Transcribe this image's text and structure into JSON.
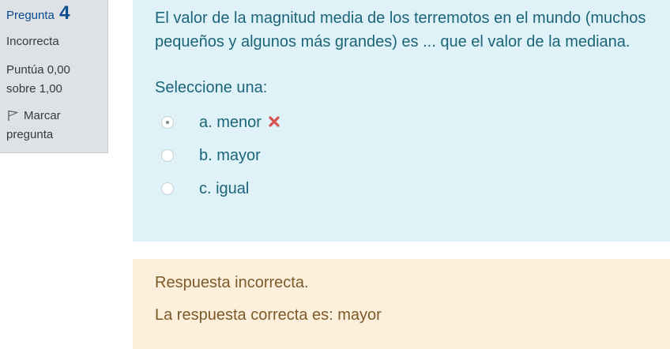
{
  "info": {
    "question_label": "Pregunta",
    "question_number": "4",
    "state": "Incorrecta",
    "grade": "Puntúa 0,00 sobre 1,00",
    "flag_label": "Marcar pregunta",
    "flag_icon": "flag-icon"
  },
  "question": {
    "text": "El valor de la magnitud media de los terremotos en el mundo (muchos pequeños y algunos más grandes) es ... que el valor de la mediana.",
    "prompt": "Seleccione una:",
    "options": [
      {
        "label": "a. menor",
        "selected": true,
        "marked_incorrect": true
      },
      {
        "label": "b. mayor",
        "selected": false
      },
      {
        "label": "c. igual",
        "selected": false
      }
    ],
    "incorrect_icon": "x-icon",
    "incorrect_color": "#d9534f"
  },
  "feedback": {
    "result": "Respuesta incorrecta.",
    "correct_answer": "La respuesta correcta es: mayor"
  },
  "colors": {
    "info_bg": "#dee2e6",
    "question_bg": "#def2f8",
    "feedback_bg": "#fcefdc",
    "question_text": "#1c6579",
    "feedback_text": "#7d5a29",
    "heading": "#0a4a8f"
  }
}
